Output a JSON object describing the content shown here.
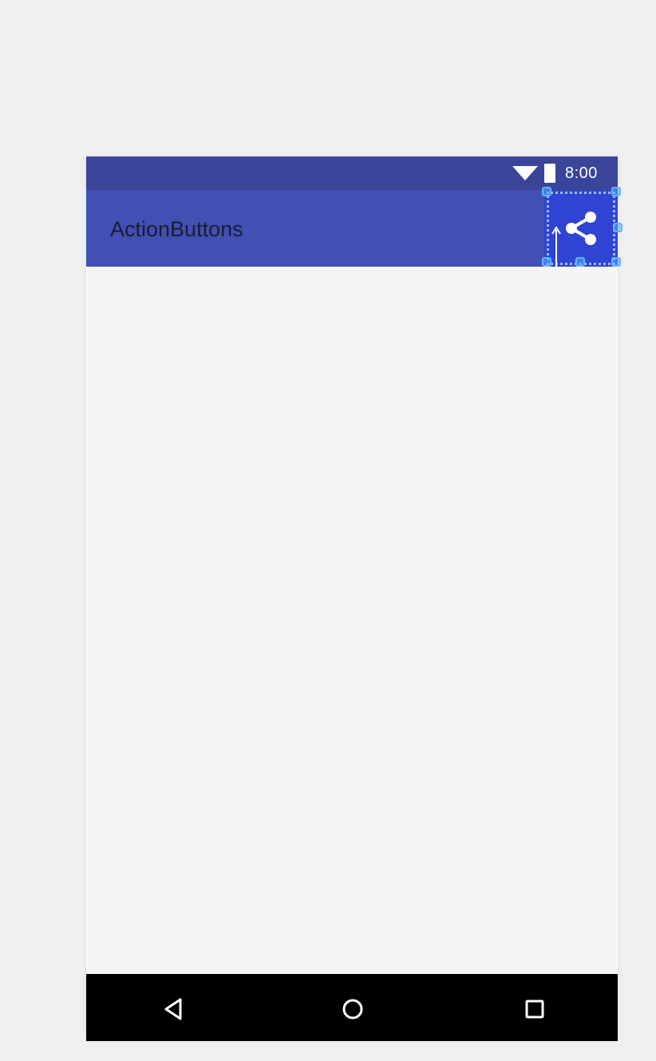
{
  "status_bar": {
    "time": "8:00",
    "wifi_icon": "wifi-icon",
    "battery_icon": "battery-icon",
    "background_color": "#3a4499"
  },
  "app_bar": {
    "title": "ActionButtons",
    "background_color": "#4150b2",
    "action": {
      "icon": "share-icon",
      "selected": true
    }
  },
  "nav_bar": {
    "back_icon": "back-triangle-icon",
    "home_icon": "home-circle-icon",
    "recents_icon": "recents-square-icon",
    "background_color": "#000000"
  }
}
